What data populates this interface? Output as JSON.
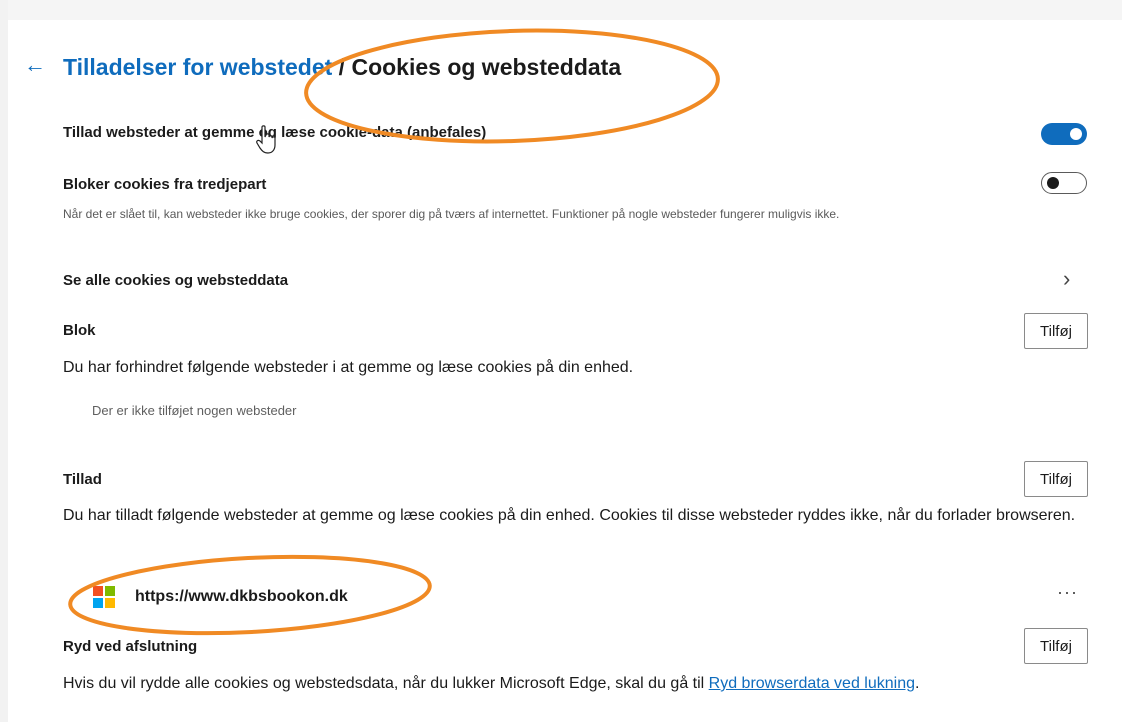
{
  "header": {
    "back_icon": "arrow-left",
    "breadcrumb_parent": "Tilladelser for webstedet",
    "breadcrumb_separator": " / ",
    "breadcrumb_current": "Cookies og websteddata"
  },
  "settings": {
    "allow_cookies": {
      "label": "Tillad websteder at gemme og læse cookie-data (anbefales)",
      "enabled": true
    },
    "block_third_party": {
      "label": "Bloker cookies fra tredjepart",
      "description": "Når det er slået til, kan websteder ikke bruge cookies, der sporer dig på tværs af internettet. Funktioner på nogle websteder fungerer muligvis ikke.",
      "enabled": false
    },
    "see_all": {
      "label": "Se alle cookies og websteddata",
      "icon": "chevron-right"
    }
  },
  "block": {
    "heading": "Blok",
    "add_label": "Tilføj",
    "description": "Du har forhindret følgende websteder i at gemme og læse cookies på din enhed.",
    "empty_text": "Der er ikke tilføjet nogen websteder"
  },
  "allow": {
    "heading": "Tillad",
    "add_label": "Tilføj",
    "description": "Du har tilladt følgende websteder at gemme og læse cookies på din enhed. Cookies til disse websteder ryddes ikke, når du forlader browseren.",
    "sites": [
      {
        "url": "https://www.dkbsbookon.dk",
        "icon": "microsoft-logo",
        "more": "···"
      }
    ]
  },
  "clear_on_exit": {
    "heading": "Ryd ved afslutning",
    "add_label": "Tilføj",
    "description_prefix": "Hvis du vil rydde alle cookies og webstedsdata, når du lukker Microsoft Edge, skal du gå til ",
    "link_text": "Ryd browserdata ved lukning",
    "description_suffix": "."
  },
  "colors": {
    "accent": "#0f6cbd",
    "annotation": "#f08a24"
  }
}
